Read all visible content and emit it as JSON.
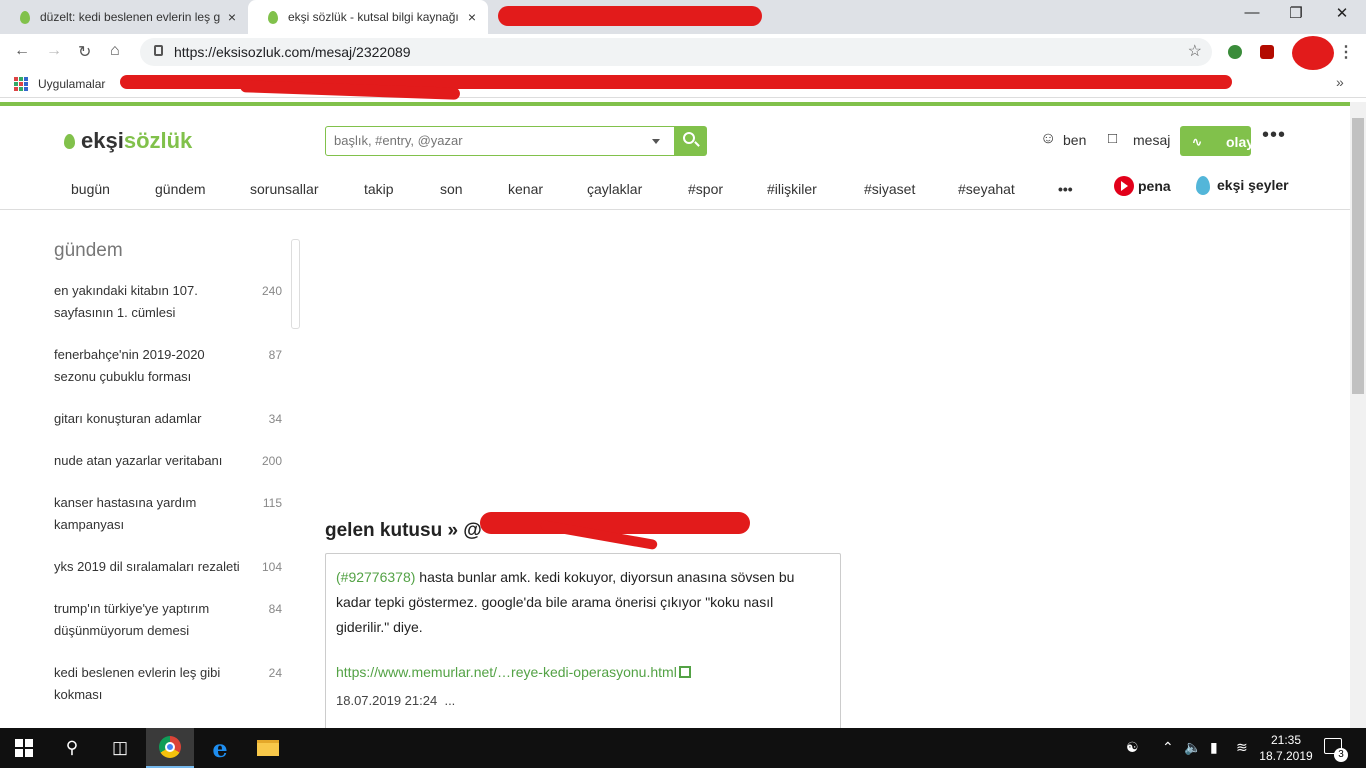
{
  "browser": {
    "tabs": [
      {
        "title": "düzelt: kedi beslenen evlerin leş g",
        "close": "×"
      },
      {
        "title": "ekşi sözlük - kutsal bilgi kaynağı",
        "close": "×"
      }
    ],
    "url": "https://eksisozluk.com/mesaj/2322089",
    "bookmarks_apps_label": "Uygulamalar",
    "window_controls": {
      "minimize": "—",
      "maximize": "❐",
      "close": "✕"
    }
  },
  "site": {
    "logo_prefix": "ekşi",
    "logo_suffix": "sözlük",
    "search_placeholder": "başlık, #entry, @yazar",
    "user_nav": {
      "ben": "ben",
      "mesaj": "mesaj",
      "olay": "olay",
      "more": "•••"
    },
    "menu": [
      "bugün",
      "gündem",
      "sorunsallar",
      "takip",
      "son",
      "kenar",
      "çaylaklar",
      "#spor",
      "#ilişkiler",
      "#siyaset",
      "#seyahat",
      "•••"
    ],
    "pena": "pena",
    "eksi_seyler": "ekşi şeyler"
  },
  "sidebar": {
    "title": "gündem",
    "items": [
      {
        "label": "en yakındaki kitabın 107. sayfasının 1. cümlesi",
        "count": "240"
      },
      {
        "label": "fenerbahçe'nin 2019-2020 sezonu çubuklu forması",
        "count": "87"
      },
      {
        "label": "gitarı konuşturan adamlar",
        "count": "34"
      },
      {
        "label": "nude atan yazarlar veritabanı",
        "count": "200"
      },
      {
        "label": "kanser hastasına yardım kampanyası",
        "count": "115"
      },
      {
        "label": "yks 2019 dil sıralamaları rezaleti",
        "count": "104"
      },
      {
        "label": "trump'ın türkiye'ye yaptırım düşünmüyorum demesi",
        "count": "84"
      },
      {
        "label": "kedi beslenen evlerin leş gibi kokması",
        "count": "24"
      }
    ]
  },
  "main": {
    "title": "gelen kutusu » @",
    "message": {
      "ref": "(#92776378)",
      "text": " hasta bunlar amk. kedi kokuyor, diyorsun anasına sövsen bu kadar tepki göstermez. google'da bile arama önerisi çıkıyor \"koku nasıl giderilir.\" diye.",
      "link": "https://www.memurlar.net/…reye-kedi-operasyonu.html",
      "date": "18.07.2019 21:24",
      "more": "..."
    }
  },
  "taskbar": {
    "time": "21:35",
    "date": "18.7.2019",
    "notification_count": "3"
  },
  "colors": {
    "brand_green": "#81c14b",
    "link_green": "#53a245",
    "redaction": "#e21b1b"
  }
}
